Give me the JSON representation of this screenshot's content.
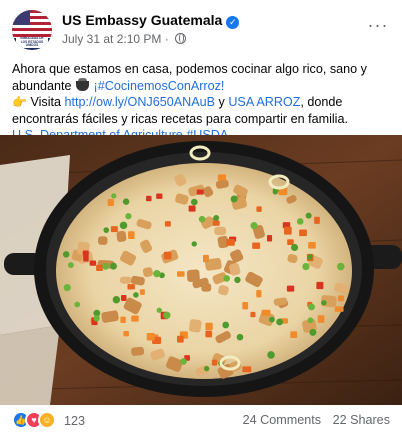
{
  "header": {
    "page_name": "US Embassy Guatemala",
    "timestamp": "July 31 at 2:10 PM",
    "separator": "·",
    "verified_icon": "verified-check-icon",
    "audience_icon": "globe-icon",
    "more_icon": "more-options-icon"
  },
  "post": {
    "line1": "Ahora que estamos en casa, podemos cocinar algo rico, sano y abundante",
    "hashtag1": "¡#CocinemosConArroz!",
    "visit_label": "Visita",
    "link1": "http://ow.ly/ONJ650ANAuB",
    "and": "y",
    "mention": "USA ARROZ",
    "line2": ", donde encontrarás fáciles y ricas recetas para compartir en familia.",
    "mention2": "U.S. Department of Agriculture",
    "hashtag2": "#USDA"
  },
  "photo": {
    "subject": "skillet of rice with chicken and vegetables"
  },
  "footer": {
    "reaction_count": "123",
    "comments": "24 Comments",
    "shares": "22 Shares",
    "reaction_icons": [
      "like-icon",
      "love-icon",
      "haha-icon"
    ]
  },
  "colors": {
    "link": "#216fdb",
    "text": "#050505",
    "muted": "#65676b",
    "verified": "#1877f2"
  }
}
